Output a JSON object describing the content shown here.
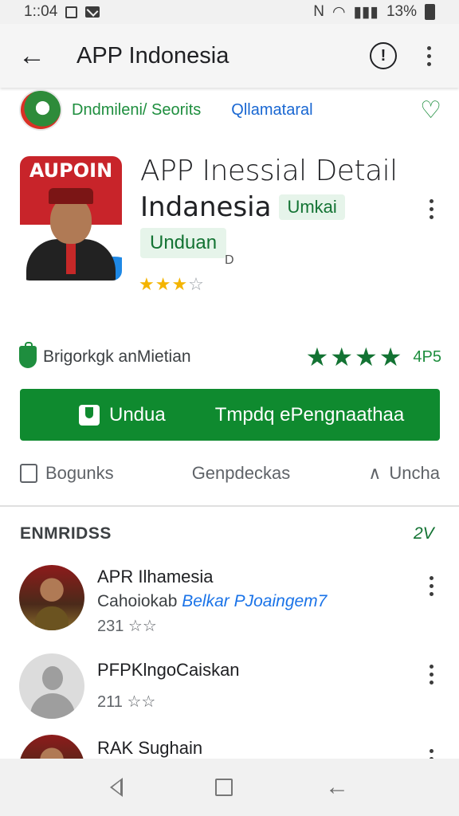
{
  "status_bar": {
    "time": "1::04",
    "signal_text": "N",
    "battery": "13%"
  },
  "app_bar": {
    "title": "APP Indonesia",
    "back_icon": "arrow-left-icon",
    "info_icon": "info-icon"
  },
  "developer": {
    "name": "Dndmileni/ Seorits",
    "link": "Qllamataral"
  },
  "app": {
    "name_line1": "APP Inessial Detail",
    "name_line2": "Indanesia",
    "tag": "Umkai",
    "install_chip": "Unduan",
    "small_mark": "D",
    "icon_badge": "AUPOIN",
    "rating_stars": "★★★☆"
  },
  "badge_row": {
    "text": "Brigorkgk anMietian",
    "stars": "★★★★",
    "score": "4P5"
  },
  "install_button": {
    "label": "Undua",
    "label2": "Tmpdq ePengnaathaa"
  },
  "actions": [
    {
      "label": "Bogunks"
    },
    {
      "label": "Genpdeckas"
    },
    {
      "label": "Uncha"
    }
  ],
  "section": {
    "title": "ENMRIDSS",
    "action": "2V"
  },
  "list": [
    {
      "title": "APR Ilhamesia",
      "sub_prefix": "Cahoiokab ",
      "sub_link": "Belkar PJoaingem7",
      "rating": "231 ☆☆"
    },
    {
      "title": "PFPKlngoCaiskan",
      "rating": "211 ☆☆"
    },
    {
      "title": "RAK Sughain"
    }
  ],
  "colors": {
    "accent_green": "#0f8a2f",
    "link_blue": "#1967d2",
    "star_gold": "#f4b400"
  }
}
